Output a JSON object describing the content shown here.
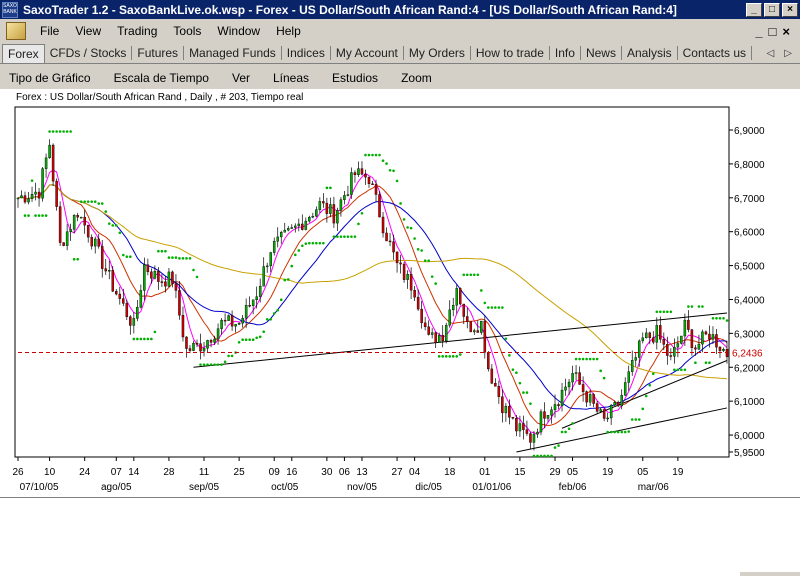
{
  "window": {
    "title": "SaxoTrader 1.2 - SaxoBankLive.ok.wsp - Forex - US Dollar/South African Rand:4 - [US Dollar/South African Rand:4]",
    "icon_label": "SAXO BANK",
    "minimize": "_",
    "maximize": "□",
    "close": "×"
  },
  "menu": {
    "items": [
      "File",
      "View",
      "Trading",
      "Tools",
      "Window",
      "Help"
    ],
    "mdi_minimize": "_",
    "mdi_restore": "□",
    "mdi_close": "×"
  },
  "tabs": [
    "Forex",
    "CFDs / Stocks",
    "Futures",
    "Managed Funds",
    "Indices",
    "My Account",
    "My Orders",
    "How to trade",
    "Info",
    "News",
    "Analysis",
    "Contacts us"
  ],
  "tab_scroll": {
    "left": "◁",
    "right": "▷"
  },
  "chart_toolbar": [
    "Tipo de Gráfico",
    "Escala de Tiempo",
    "Ver",
    "Líneas",
    "Estudios",
    "Zoom"
  ],
  "chart_data": {
    "type": "candlestick",
    "title": "Forex : US Dollar/South African Rand , Daily , # 203, Tiempo real",
    "current_price": "6,2436",
    "current_value": 6.2436,
    "ylim": [
      5.93,
      6.96
    ],
    "y_ticks": [
      "6,9000",
      "6,8000",
      "6,7000",
      "6,6000",
      "6,5000",
      "6,4000",
      "6,3000",
      "6,2000",
      "6,1000",
      "6,0000",
      "5,9500"
    ],
    "y_tick_values": [
      6.9,
      6.8,
      6.7,
      6.6,
      6.5,
      6.4,
      6.3,
      6.2,
      6.1,
      6.0,
      5.95
    ],
    "x_day_ticks": [
      {
        "label": "26",
        "i": 0
      },
      {
        "label": "10",
        "i": 9
      },
      {
        "label": "24",
        "i": 19
      },
      {
        "label": "07",
        "i": 28
      },
      {
        "label": "14",
        "i": 33
      },
      {
        "label": "28",
        "i": 43
      },
      {
        "label": "11",
        "i": 53
      },
      {
        "label": "25",
        "i": 63
      },
      {
        "label": "09",
        "i": 73
      },
      {
        "label": "16",
        "i": 78
      },
      {
        "label": "30",
        "i": 88
      },
      {
        "label": "06",
        "i": 93
      },
      {
        "label": "13",
        "i": 98
      },
      {
        "label": "27",
        "i": 108
      },
      {
        "label": "04",
        "i": 113
      },
      {
        "label": "18",
        "i": 123
      },
      {
        "label": "01",
        "i": 133
      },
      {
        "label": "15",
        "i": 143
      },
      {
        "label": "29",
        "i": 153
      },
      {
        "label": "05",
        "i": 158
      },
      {
        "label": "19",
        "i": 168
      },
      {
        "label": "05",
        "i": 178
      },
      {
        "label": "19",
        "i": 188
      }
    ],
    "x_month_ticks": [
      {
        "label": "07/10/05",
        "i": 6
      },
      {
        "label": "ago/05",
        "i": 28
      },
      {
        "label": "sep/05",
        "i": 53
      },
      {
        "label": "oct/05",
        "i": 76
      },
      {
        "label": "nov/05",
        "i": 98
      },
      {
        "label": "dic/05",
        "i": 117
      },
      {
        "label": "01/01/06",
        "i": 135
      },
      {
        "label": "feb/06",
        "i": 158
      },
      {
        "label": "mar/06",
        "i": 181
      }
    ],
    "n_bars": 203,
    "waypoints": [
      [
        0,
        6.7
      ],
      [
        6,
        6.72
      ],
      [
        9,
        6.86
      ],
      [
        12,
        6.56
      ],
      [
        17,
        6.66
      ],
      [
        21,
        6.58
      ],
      [
        27,
        6.44
      ],
      [
        33,
        6.32
      ],
      [
        36,
        6.5
      ],
      [
        40,
        6.46
      ],
      [
        44,
        6.46
      ],
      [
        48,
        6.25
      ],
      [
        53,
        6.27
      ],
      [
        58,
        6.33
      ],
      [
        63,
        6.33
      ],
      [
        68,
        6.42
      ],
      [
        72,
        6.55
      ],
      [
        78,
        6.6
      ],
      [
        86,
        6.68
      ],
      [
        90,
        6.65
      ],
      [
        96,
        6.77
      ],
      [
        100,
        6.76
      ],
      [
        104,
        6.62
      ],
      [
        108,
        6.5
      ],
      [
        113,
        6.43
      ],
      [
        117,
        6.28
      ],
      [
        121,
        6.3
      ],
      [
        125,
        6.44
      ],
      [
        128,
        6.32
      ],
      [
        132,
        6.33
      ],
      [
        134,
        6.2
      ],
      [
        138,
        6.09
      ],
      [
        142,
        6.02
      ],
      [
        146,
        5.99
      ],
      [
        150,
        6.07
      ],
      [
        154,
        6.11
      ],
      [
        158,
        6.18
      ],
      [
        163,
        6.1
      ],
      [
        167,
        6.04
      ],
      [
        171,
        6.09
      ],
      [
        175,
        6.2
      ],
      [
        178,
        6.28
      ],
      [
        182,
        6.3
      ],
      [
        186,
        6.22
      ],
      [
        190,
        6.32
      ],
      [
        193,
        6.26
      ],
      [
        197,
        6.3
      ],
      [
        202,
        6.24
      ]
    ],
    "indicators": [
      "Parabolic SAR",
      "Moving Average (short)",
      "Moving Average (medium)",
      "Moving Average (long)"
    ],
    "colors": {
      "up": "#00aa00",
      "down": "#cc0000",
      "sar": "#00b000",
      "ma_short": "#ff00ff",
      "ma_mid": "#cc3300",
      "ma_blue": "#0000cc",
      "ma_long": "#c8a000",
      "trend": "#000000",
      "price_line": "#cc0000",
      "axis_text": "#000000"
    }
  }
}
